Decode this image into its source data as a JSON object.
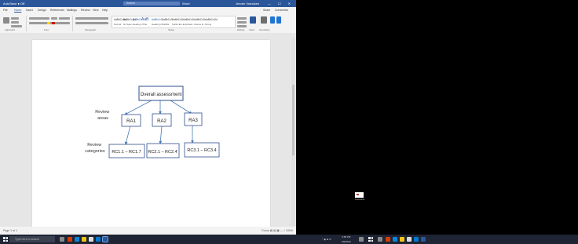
{
  "titlebar": {
    "app_label": "AutoSave ● Off",
    "doc_title": "Word",
    "search_placeholder": "Search",
    "user": "Jeroen Vrancken",
    "window_controls": "— ☐ ✕"
  },
  "menu": {
    "items": [
      "File",
      "Home",
      "Insert",
      "Design",
      "References",
      "Mailings",
      "Review",
      "View",
      "Help"
    ],
    "right_items": [
      "Share",
      "Comments"
    ]
  },
  "ribbon": {
    "group_labels": [
      "Clipboard",
      "Font",
      "Paragraph",
      "Styles",
      "Editing",
      "Voice",
      "Sensitivity"
    ],
    "styles": [
      "AaBbCcDd",
      "AaBbCcDd",
      "AaBbCc",
      "AaBbCcC",
      "AaB",
      "AaBbCcC",
      "AaBbCcD",
      "AaBbCcD",
      "AaBbCcD",
      "AaBbCcDd"
    ],
    "style_names": [
      "Normal",
      "No Spac...",
      "Heading 1",
      "Heading 2",
      "Title",
      "Subtitle",
      "Subtle Em...",
      "Emphasis",
      "Intense E...",
      "Strong"
    ]
  },
  "diagram": {
    "root": "Overall assessment",
    "left_labels": [
      "Review areas",
      "Review categories"
    ],
    "areas": [
      "RA1",
      "RA2",
      "RA3"
    ],
    "categories": [
      "RC1.1 – RC1.7",
      "RC2.1 – RC2.4",
      "RC3.1 – RC3.4"
    ]
  },
  "statusbar": {
    "left": "Page 1 of 1",
    "right": "Focus  ▤  ▥  ▦  — + 100%"
  },
  "desktop": {
    "thumbnail_caption": "screenshot"
  },
  "taskbar": {
    "search_placeholder": "Type here to search",
    "clock_time": "3:58 PM",
    "clock_date": "4/6/2022"
  },
  "colors": {
    "word_blue": "#2b579a",
    "diagram_box_border": "#2f4f8f",
    "arrow": "#4a7ab5"
  }
}
